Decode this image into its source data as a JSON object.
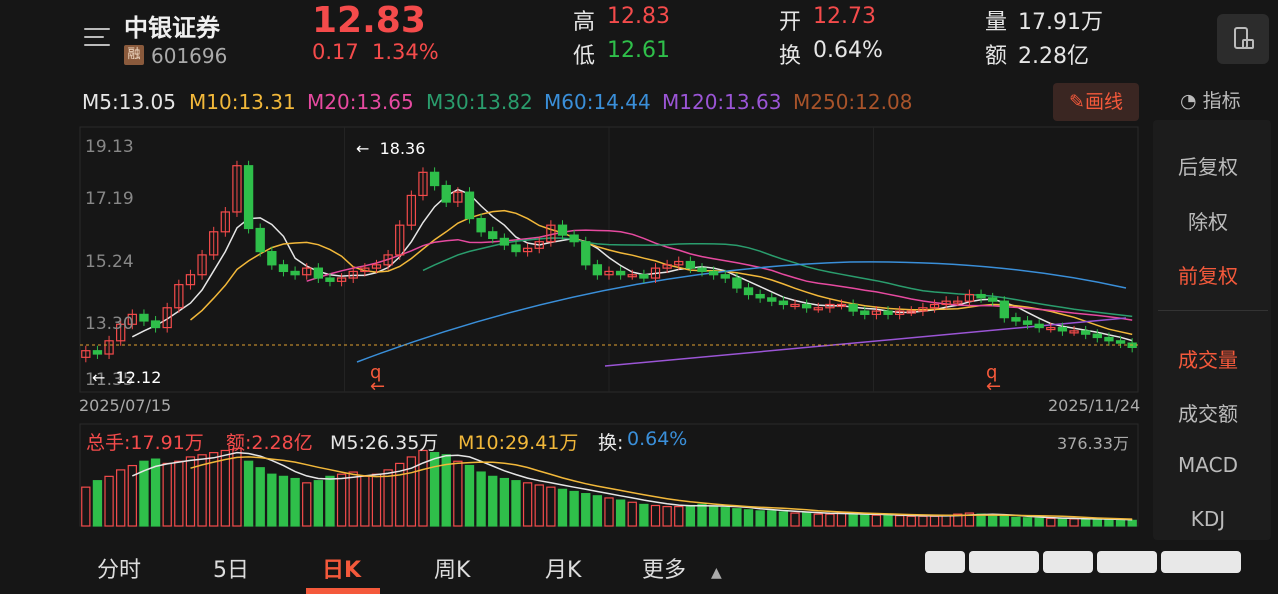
{
  "header": {
    "name": "中银证券",
    "badge": "融",
    "code": "601696",
    "price": "12.83",
    "change": "0.17",
    "change_pct": "1.34%",
    "high_label": "高",
    "high_value": "12.83",
    "low_label": "低",
    "low_value": "12.61",
    "open_label": "开",
    "open_value": "12.73",
    "turnover_label": "换",
    "turnover_value": "0.64%",
    "volume_label": "量",
    "volume_value": "17.91万",
    "amount_label": "额",
    "amount_value": "2.28亿"
  },
  "ma_legend": [
    {
      "text": "M5:13.05",
      "color": "#e6e6e6"
    },
    {
      "text": "M10:13.31",
      "color": "#f2b83a"
    },
    {
      "text": "M20:13.65",
      "color": "#e64aa0"
    },
    {
      "text": "M30:13.82",
      "color": "#2a9d6d"
    },
    {
      "text": "M60:14.44",
      "color": "#3a8fd9"
    },
    {
      "text": "M120:13.63",
      "color": "#9b55d6"
    },
    {
      "text": "M250:12.08",
      "color": "#a8532a"
    }
  ],
  "draw_button": "画线",
  "indicator_label": "指标",
  "side_menu": [
    "后复权",
    "除权",
    "前复权",
    "成交量",
    "成交额",
    "MACD",
    "KDJ"
  ],
  "side_active": [
    "前复权",
    "成交量"
  ],
  "main_chart": {
    "ytick_labels": [
      "19.13",
      "17.19",
      "15.24",
      "13.30",
      "11.35"
    ],
    "max_label": "18.36",
    "min_label": "12.12",
    "start_date": "2025/07/15",
    "end_date": "2025/11/24",
    "marker_glyph": "q"
  },
  "volume_legend": {
    "total": "总手:17.91万",
    "amount": "额:2.28亿",
    "m5": "M5:26.35万",
    "m10": "M10:29.41万",
    "turnover_label": "换:",
    "turnover_value": "0.64%",
    "max_label": "376.33万"
  },
  "tabs": [
    "分时",
    "5日",
    "日K",
    "周K",
    "月K",
    "更多"
  ],
  "active_tab": "日K",
  "colors": {
    "up": "#f44b4b",
    "down": "#2fbf4a",
    "accent": "#f4593b",
    "bg": "#161616"
  },
  "chart_data": {
    "type": "candlestick",
    "ylim": [
      11.35,
      19.13
    ],
    "closes": [
      12.6,
      12.5,
      12.9,
      13.4,
      13.7,
      13.5,
      13.3,
      13.9,
      14.6,
      14.9,
      15.5,
      16.2,
      16.8,
      18.2,
      16.3,
      15.6,
      15.2,
      15.0,
      14.9,
      15.1,
      14.8,
      14.7,
      14.8,
      15.0,
      15.1,
      15.2,
      15.5,
      16.4,
      17.3,
      18.0,
      17.6,
      17.1,
      17.4,
      16.6,
      16.2,
      16.0,
      15.8,
      15.6,
      15.7,
      15.9,
      16.4,
      16.1,
      15.9,
      15.2,
      14.9,
      15.0,
      14.9,
      14.9,
      14.8,
      15.1,
      15.2,
      15.3,
      15.1,
      15.0,
      14.9,
      14.8,
      14.5,
      14.3,
      14.2,
      14.1,
      14.0,
      14.0,
      13.9,
      13.9,
      14.0,
      14.0,
      13.8,
      13.7,
      13.8,
      13.7,
      13.8,
      13.8,
      13.9,
      14.0,
      14.1,
      14.1,
      14.3,
      14.2,
      14.1,
      13.6,
      13.5,
      13.4,
      13.3,
      13.3,
      13.2,
      13.2,
      13.1,
      13.0,
      12.9,
      12.83,
      12.7
    ],
    "volumes": [
      180,
      210,
      230,
      260,
      280,
      300,
      310,
      290,
      300,
      320,
      330,
      340,
      350,
      360,
      300,
      270,
      240,
      230,
      220,
      200,
      210,
      230,
      240,
      250,
      230,
      240,
      260,
      290,
      320,
      350,
      340,
      330,
      300,
      280,
      250,
      230,
      220,
      210,
      200,
      190,
      180,
      170,
      160,
      150,
      140,
      130,
      120,
      110,
      100,
      95,
      90,
      90,
      95,
      100,
      90,
      85,
      80,
      75,
      70,
      70,
      65,
      60,
      60,
      55,
      55,
      60,
      55,
      50,
      50,
      50,
      48,
      45,
      45,
      45,
      50,
      55,
      60,
      55,
      50,
      45,
      40,
      38,
      36,
      35,
      34,
      33,
      32,
      30,
      30,
      28,
      26
    ]
  }
}
